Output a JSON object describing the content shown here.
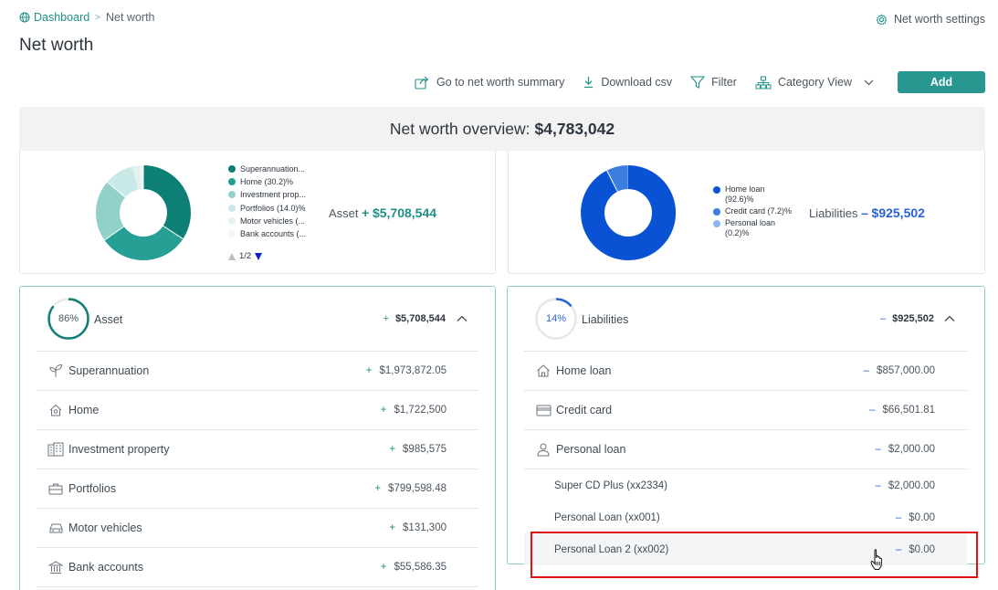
{
  "breadcrumb": {
    "home": "Dashboard",
    "separator": ">",
    "current": "Net worth"
  },
  "page_title": "Net worth",
  "settings_label": "Net worth settings",
  "toolbar": {
    "summary": "Go to net worth summary",
    "download": "Download csv",
    "filter": "Filter",
    "category_view": "Category View",
    "add": "Add"
  },
  "overview": {
    "label": "Net worth overview:",
    "value": "$4,783,042"
  },
  "asset_chart": {
    "legend": [
      {
        "label": "Superannuation...",
        "color": "#0d7f75"
      },
      {
        "label": "Home (30.2)%",
        "color": "#26a094"
      },
      {
        "label": "Investment prop...",
        "color": "#92d1ca"
      },
      {
        "label": "Portfolios (14.0)%",
        "color": "#c8e9e5"
      },
      {
        "label": "Motor vehicles (...",
        "color": "#e3f2f0"
      },
      {
        "label": "Bank accounts (...",
        "color": "#f2f7f6"
      }
    ],
    "pager": "1/2",
    "total_label": "Asset",
    "total_sign": "+",
    "total_value": "$5,708,544"
  },
  "liab_chart": {
    "legend": [
      {
        "label": "Home loan",
        "label2": "(92.6)%",
        "color": "#0a52d4"
      },
      {
        "label": "Credit card (7.2)%",
        "label2": "",
        "color": "#3a7ee0"
      },
      {
        "label": "Personal loan",
        "label2": "(0.2)%",
        "color": "#8cb5ee"
      }
    ],
    "total_label": "Liabilities",
    "total_sign": "–",
    "total_value": "$925,502"
  },
  "asset_panel": {
    "percent": "86%",
    "percent_value": 0.86,
    "label": "Asset",
    "sign": "+",
    "total": "$5,708,544",
    "rows": [
      {
        "icon": "seedling-icon",
        "name": "Superannuation",
        "sign": "+",
        "amount": "$1,973,872.05"
      },
      {
        "icon": "home-icon",
        "name": "Home",
        "sign": "+",
        "amount": "$1,722,500"
      },
      {
        "icon": "building-icon",
        "name": "Investment property",
        "sign": "+",
        "amount": "$985,575"
      },
      {
        "icon": "briefcase-icon",
        "name": "Portfolios",
        "sign": "+",
        "amount": "$799,598.48"
      },
      {
        "icon": "car-icon",
        "name": "Motor vehicles",
        "sign": "+",
        "amount": "$131,300"
      },
      {
        "icon": "bank-icon",
        "name": "Bank accounts",
        "sign": "+",
        "amount": "$55,586.35"
      }
    ]
  },
  "liab_panel": {
    "percent": "14%",
    "percent_value": 0.14,
    "label": "Liabilities",
    "sign": "–",
    "total": "$925,502",
    "rows": [
      {
        "icon": "house-outline-icon",
        "name": "Home loan",
        "sign": "–",
        "amount": "$857,000.00"
      },
      {
        "icon": "credit-card-icon",
        "name": "Credit card",
        "sign": "–",
        "amount": "$66,501.81"
      },
      {
        "icon": "person-icon",
        "name": "Personal loan",
        "sign": "–",
        "amount": "$2,000.00"
      }
    ],
    "sub_rows": [
      {
        "name": "Super CD Plus (xx2334)",
        "sign": "–",
        "amount": "$2,000.00"
      },
      {
        "name": "Personal Loan (xx001)",
        "sign": "–",
        "amount": "$0.00"
      },
      {
        "name": "Personal Loan 2 (xx002)",
        "sign": "–",
        "amount": "$0.00"
      }
    ]
  }
}
